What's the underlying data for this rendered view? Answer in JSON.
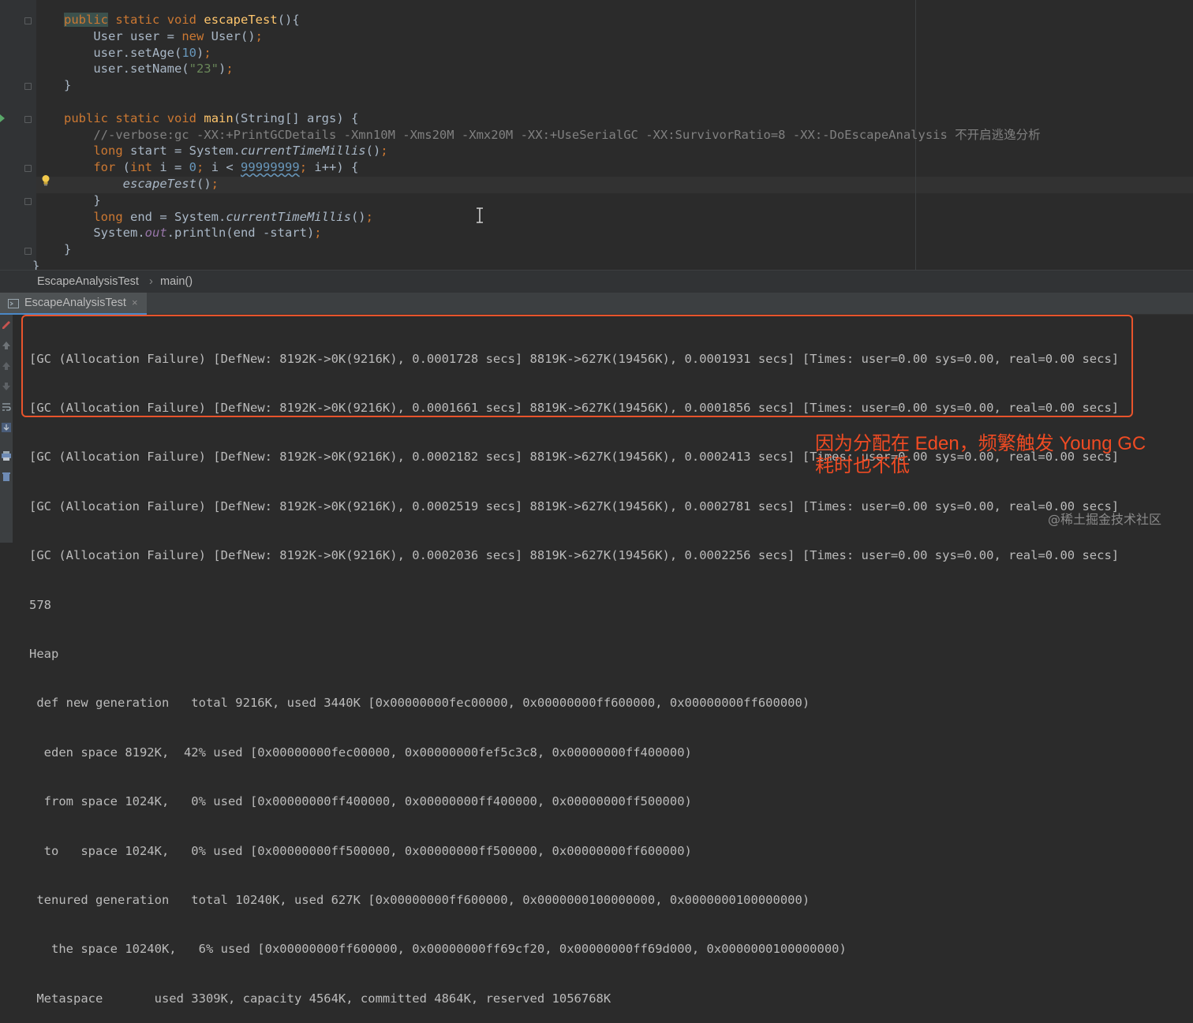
{
  "editor": {
    "code_lines": [
      [
        {
          "t": "public",
          "c": "kwhl"
        },
        {
          "t": " ",
          "c": ""
        },
        {
          "t": "static",
          "c": "kw"
        },
        {
          "t": " ",
          "c": ""
        },
        {
          "t": "void",
          "c": "kw"
        },
        {
          "t": " ",
          "c": ""
        },
        {
          "t": "escapeTest",
          "c": "fn"
        },
        {
          "t": "(){",
          "c": ""
        }
      ],
      [
        {
          "t": "    User user = ",
          "c": ""
        },
        {
          "t": "new",
          "c": "kw"
        },
        {
          "t": " User()",
          "c": ""
        },
        {
          "t": ";",
          "c": "kw"
        }
      ],
      [
        {
          "t": "    user.setAge(",
          "c": ""
        },
        {
          "t": "10",
          "c": "num"
        },
        {
          "t": ")",
          "c": ""
        },
        {
          "t": ";",
          "c": "kw"
        }
      ],
      [
        {
          "t": "    user.setName(",
          "c": ""
        },
        {
          "t": "\"23\"",
          "c": "str"
        },
        {
          "t": ")",
          "c": ""
        },
        {
          "t": ";",
          "c": "kw"
        }
      ],
      [
        {
          "t": "}",
          "c": ""
        }
      ],
      [
        {
          "t": "",
          "c": ""
        }
      ],
      [
        {
          "t": "public",
          "c": "kw"
        },
        {
          "t": " ",
          "c": ""
        },
        {
          "t": "static",
          "c": "kw"
        },
        {
          "t": " ",
          "c": ""
        },
        {
          "t": "void",
          "c": "kw"
        },
        {
          "t": " ",
          "c": ""
        },
        {
          "t": "main",
          "c": "fn"
        },
        {
          "t": "(String[] args) {",
          "c": ""
        }
      ],
      [
        {
          "t": "    //-verbose:gc -XX:+PrintGCDetails -Xmn10M -Xms20M -Xmx20M -XX:+UseSerialGC -XX:SurvivorRatio=8 -XX:-DoEscapeAnalysis 不开启逃逸分析",
          "c": "cmt"
        }
      ],
      [
        {
          "t": "    ",
          "c": ""
        },
        {
          "t": "long",
          "c": "kw"
        },
        {
          "t": " start = System.",
          "c": ""
        },
        {
          "t": "currentTimeMillis",
          "c": "it"
        },
        {
          "t": "()",
          "c": ""
        },
        {
          "t": ";",
          "c": "kw"
        }
      ],
      [
        {
          "t": "    ",
          "c": ""
        },
        {
          "t": "for",
          "c": "kw"
        },
        {
          "t": " (",
          "c": ""
        },
        {
          "t": "int",
          "c": "kw"
        },
        {
          "t": " i = ",
          "c": ""
        },
        {
          "t": "0",
          "c": "num"
        },
        {
          "t": ";",
          "c": "kw"
        },
        {
          "t": " i < ",
          "c": ""
        },
        {
          "t": "99999999",
          "c": "num squig"
        },
        {
          "t": ";",
          "c": "kw"
        },
        {
          "t": " i++) {",
          "c": ""
        }
      ],
      [
        {
          "t": "        ",
          "c": ""
        },
        {
          "t": "escapeTest",
          "c": "it"
        },
        {
          "t": "()",
          "c": ""
        },
        {
          "t": ";",
          "c": "kw"
        }
      ],
      [
        {
          "t": "    }",
          "c": ""
        }
      ],
      [
        {
          "t": "    ",
          "c": ""
        },
        {
          "t": "long",
          "c": "kw"
        },
        {
          "t": " end = System.",
          "c": ""
        },
        {
          "t": "currentTimeMillis",
          "c": "it"
        },
        {
          "t": "()",
          "c": ""
        },
        {
          "t": ";",
          "c": "kw"
        }
      ],
      [
        {
          "t": "    System.",
          "c": ""
        },
        {
          "t": "out",
          "c": "fld"
        },
        {
          "t": ".println(end -start)",
          "c": ""
        },
        {
          "t": ";",
          "c": "kw"
        }
      ],
      [
        {
          "t": "}",
          "c": ""
        }
      ],
      [
        {
          "t": "}",
          "c": ""
        }
      ]
    ]
  },
  "breadcrumb": {
    "class_name": "EscapeAnalysisTest",
    "separator": "›",
    "method_name": "main()"
  },
  "run_panel": {
    "tab_label": "EscapeAnalysisTest",
    "tab_close": "×"
  },
  "console": {
    "gc_lines": [
      "[GC (Allocation Failure) [DefNew: 8192K->0K(9216K), 0.0001728 secs] 8819K->627K(19456K), 0.0001931 secs] [Times: user=0.00 sys=0.00, real=0.00 secs]",
      "[GC (Allocation Failure) [DefNew: 8192K->0K(9216K), 0.0001661 secs] 8819K->627K(19456K), 0.0001856 secs] [Times: user=0.00 sys=0.00, real=0.00 secs]",
      "[GC (Allocation Failure) [DefNew: 8192K->0K(9216K), 0.0002182 secs] 8819K->627K(19456K), 0.0002413 secs] [Times: user=0.00 sys=0.00, real=0.00 secs]",
      "[GC (Allocation Failure) [DefNew: 8192K->0K(9216K), 0.0002519 secs] 8819K->627K(19456K), 0.0002781 secs] [Times: user=0.00 sys=0.00, real=0.00 secs]",
      "[GC (Allocation Failure) [DefNew: 8192K->0K(9216K), 0.0002036 secs] 8819K->627K(19456K), 0.0002256 secs] [Times: user=0.00 sys=0.00, real=0.00 secs]"
    ],
    "elapsed": "578",
    "heap_lines": [
      "Heap",
      " def new generation   total 9216K, used 3440K [0x00000000fec00000, 0x00000000ff600000, 0x00000000ff600000)",
      "  eden space 8192K,  42% used [0x00000000fec00000, 0x00000000fef5c3c8, 0x00000000ff400000)",
      "  from space 1024K,   0% used [0x00000000ff400000, 0x00000000ff400000, 0x00000000ff500000)",
      "  to   space 1024K,   0% used [0x00000000ff500000, 0x00000000ff500000, 0x00000000ff600000)",
      " tenured generation   total 10240K, used 627K [0x00000000ff600000, 0x0000000100000000, 0x0000000100000000)",
      "   the space 10240K,   6% used [0x00000000ff600000, 0x00000000ff69cf20, 0x00000000ff69d000, 0x0000000100000000)",
      " Metaspace       used 3309K, capacity 4564K, committed 4864K, reserved 1056768K"
    ]
  },
  "annotation": {
    "line1": "因为分配在 Eden，频繁触发 Young GC",
    "line2": "耗时也不低"
  },
  "watermark": "@稀土掘金技术社区",
  "colors": {
    "editor_bg": "#2b2b2b",
    "keyword": "#cc7832",
    "method": "#ffc66d",
    "number": "#6897bb",
    "string": "#6a8759",
    "comment": "#808080",
    "annotation_red": "#ef4b23"
  },
  "icons": [
    "fold-marker-icon",
    "run-gutter-icon",
    "lightbulb-icon",
    "text-cursor-icon",
    "run-tab-icon",
    "edit-icon",
    "up-arrow-icon",
    "down-arrow-icon",
    "soft-wrap-icon",
    "scroll-end-icon",
    "print-icon",
    "trash-icon"
  ]
}
